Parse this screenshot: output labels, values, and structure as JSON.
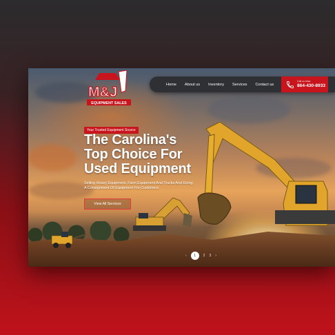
{
  "brand": {
    "logo_letters": "M&J",
    "logo_tagline": "EQUIPMENT SALES"
  },
  "nav": {
    "items": [
      "Home",
      "About us",
      "Inventory",
      "Services",
      "Contact us"
    ]
  },
  "phone": {
    "label": "Call us Now",
    "number": "864-430-8933"
  },
  "hero": {
    "tag": "Your Trusted Equipment Source",
    "title_line1": "The Carolina's",
    "title_line2": "Top Choice For",
    "title_line3": "Used Equipment",
    "subtitle": "Selling Heavy Equipment, Farm Equipment And Trucks And Doing A Consignment Of Equipment For Customers",
    "cta_label": "View All Services"
  },
  "slider": {
    "prev": "‹",
    "next": "›",
    "pages": [
      "1",
      "2",
      "3"
    ],
    "active": "1"
  },
  "colors": {
    "accent": "#c8141c",
    "nav_bg": "#2f3033"
  }
}
